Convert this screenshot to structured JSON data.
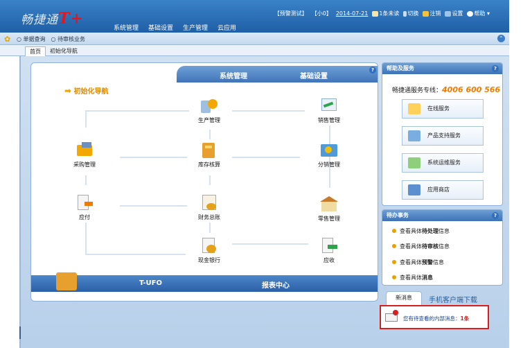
{
  "app": {
    "logo_text": "畅捷通",
    "logo_suffix": "T+"
  },
  "main_menu": [
    "系统管理",
    "基础设置",
    "生产管理",
    "云应用"
  ],
  "top_toolbar": {
    "items": [
      {
        "label": "【预警测试】",
        "icon": ""
      },
      {
        "label": "【小0】",
        "icon": ""
      },
      {
        "label": "2014-07-21",
        "icon": ""
      },
      {
        "label": "1条未读",
        "icon": "mail-icon"
      },
      {
        "label": "切换",
        "icon": "switch-icon"
      },
      {
        "label": "注销",
        "icon": "lock-icon"
      },
      {
        "label": "设置",
        "icon": "settings-icon"
      },
      {
        "label": "帮助",
        "icon": "help-icon"
      }
    ]
  },
  "quick_bar": {
    "items": [
      "单据查询",
      "待审核业务"
    ]
  },
  "tabs": [
    "首页",
    "初始化导航"
  ],
  "panel": {
    "head_left": "系统管理",
    "head_right": "基础设置",
    "nav_title": "初始化导航",
    "nodes": {
      "production": "生产管理",
      "sales": "销售管理",
      "purchase": "采购管理",
      "inventory": "库存核算",
      "distribution": "分销管理",
      "payable": "应付",
      "finance": "财务总账",
      "retail": "零售管理",
      "cash": "现金银行",
      "receivable": "应收"
    },
    "bottom_left": "T-UFO",
    "bottom_right": "报表中心"
  },
  "help_service": {
    "title": "帮助及服务",
    "hotline_label": "畅捷通服务专线：",
    "hotline_number": "4006 600 566",
    "buttons": [
      "在线服务",
      "产品支持服务",
      "系统运维服务",
      "应用商店"
    ]
  },
  "todo": {
    "title": "待办事务",
    "items": [
      {
        "prefix": "查看具体",
        "bold": "待处理",
        "suffix": "信息"
      },
      {
        "prefix": "查看具体",
        "bold": "待审核",
        "suffix": "信息"
      },
      {
        "prefix": "查看具体",
        "bold": "预警",
        "suffix": "信息"
      },
      {
        "prefix": "查看具体",
        "bold": "消息",
        "suffix": ""
      }
    ]
  },
  "news": {
    "tab_new": "新消息",
    "tab_mobile": "手机客户端下载",
    "message_prefix": "您有待查看的内部消息：",
    "message_count": "1条"
  },
  "colors": {
    "accent_orange": "#e08a00",
    "hotline_orange": "#f07a00",
    "alert_red": "#d42020",
    "brand_blue": "#1f5fa6"
  }
}
